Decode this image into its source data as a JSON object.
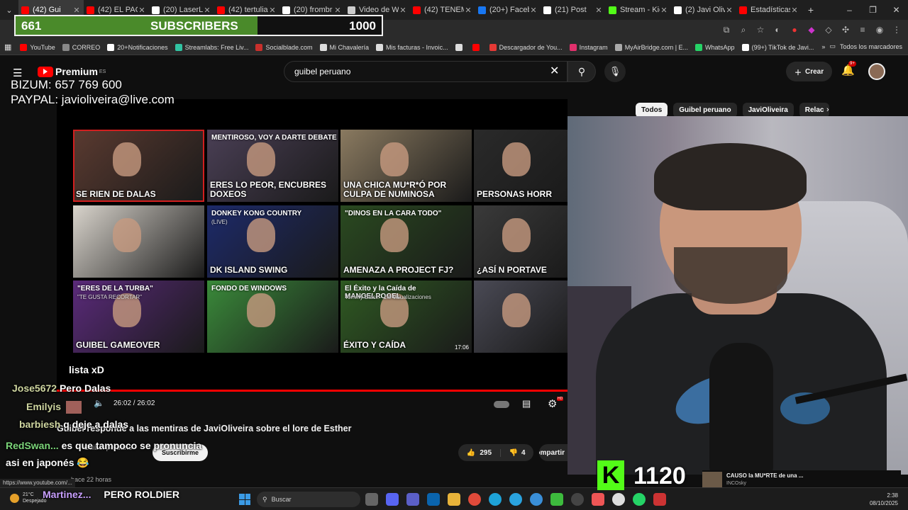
{
  "browser": {
    "tabs": [
      {
        "title": "(42) Gui",
        "color": "#ff0000",
        "active": true
      },
      {
        "title": "(42) EL PACT",
        "color": "#ff0000"
      },
      {
        "title": "(20) LaserLe",
        "color": "#ffffff"
      },
      {
        "title": "(42) tertulia",
        "color": "#ff0000"
      },
      {
        "title": "(20) frombr",
        "color": "#ffffff"
      },
      {
        "title": "Video de W",
        "color": "#cccccc"
      },
      {
        "title": "(42) TENEM",
        "color": "#ff0000"
      },
      {
        "title": "(20+) Facebo",
        "color": "#1877f2"
      },
      {
        "title": "(21) Post",
        "color": "#ffffff"
      },
      {
        "title": "Stream - Kic",
        "color": "#53fc18"
      },
      {
        "title": "(2) Javi Olive",
        "color": "#ffffff"
      },
      {
        "title": "Estadísticas",
        "color": "#ff0000"
      }
    ],
    "bookmarks": [
      {
        "label": "YouTube",
        "color": "#ff0000"
      },
      {
        "label": "CORREO",
        "color": "#888888"
      },
      {
        "label": "20+Notificaciones",
        "color": "#ffffff"
      },
      {
        "label": "Streamlabs: Free Liv...",
        "color": "#31c3a2"
      },
      {
        "label": "Socialblade.com",
        "color": "#c9302c"
      },
      {
        "label": "Mi Chavalería",
        "color": "#dddddd"
      },
      {
        "label": "Mis facturas - Invoic...",
        "color": "#dddddd"
      },
      {
        "label": "",
        "color": "#dddddd"
      },
      {
        "label": "",
        "color": "#ff0000"
      },
      {
        "label": "Descargador de You...",
        "color": "#e53935"
      },
      {
        "label": "Instagram",
        "color": "#e1306c"
      },
      {
        "label": "MyAirBridge.com | E...",
        "color": "#aaaaaa"
      },
      {
        "label": "WhatsApp",
        "color": "#25d366"
      },
      {
        "label": "(99+) TikTok de Javi...",
        "color": "#ffffff"
      }
    ],
    "bookmarks_all": "Todos los marcadores",
    "status_url": "https://www.youtube.com/..."
  },
  "overlay": {
    "subscribers": {
      "current": "661",
      "label": "SUBSCRIBERS",
      "goal": "1000",
      "progress": 0.661
    },
    "donation_lines": [
      "BIZUM: 657 769 600",
      "PAYPAL: javioliveira@live.com"
    ],
    "kick_logo": "K",
    "kick_followers": "1120"
  },
  "youtube": {
    "logo_text": "Premium",
    "logo_region": "ES",
    "search_query": "guibel peruano",
    "create_label": "Crear",
    "notif_badge": "9+",
    "chips": [
      "Todos",
      "Guibel peruano",
      "JaviOliveira",
      "Relac"
    ],
    "player": {
      "time": "26:02 / 26:02",
      "endscreen": [
        {
          "caption": "SE RIEN DE DALAS",
          "bg": "#5a3a30",
          "border": "#d21f1f"
        },
        {
          "caption": "ERES LO PEOR, ENCUBRES DOXEOS",
          "caption2": "MENTIROSO, VOY A DARTE DEBATE",
          "bg": "#4a3f55"
        },
        {
          "caption": "UNA CHICA MU*R*Ó POR CULPA DE NUMINOSA",
          "bg": "#8a7a60"
        },
        {
          "caption": "PERSONAS HORR",
          "bg": "#2a2a2a"
        },
        {
          "caption": "",
          "bg": "#d9d4cc"
        },
        {
          "caption": "DK ISLAND SWING",
          "caption2": "DONKEY KONG COUNTRY",
          "sub": "(LIVE)",
          "bg": "#1d2a6a"
        },
        {
          "caption": "AMENAZA A PROJECT FJ?",
          "caption2": "\"DINOS EN LA CARA TODO\"",
          "bg": "#2a4a20"
        },
        {
          "caption": "¿ASÍ N PORTAVE",
          "bg": "#3a3a3a"
        },
        {
          "caption": "GUIBEL GAMEOVER",
          "caption2": "\"ERES DE LA TURBA\"",
          "sub": "\"TE GUSTA RECORTAR\"",
          "bg": "#5a2a7a"
        },
        {
          "caption": "",
          "caption2": "FONDO DE WINDOWS",
          "bg": "#3a8a3a"
        },
        {
          "caption": "ÉXITO Y CAÍDA",
          "caption2": "El Éxito y la Caída de MANGELROGEL",
          "sub": "Tommy Black · 1M visualizaciones",
          "duration": "17:06",
          "bg": "#2f5a22"
        },
        {
          "caption": "",
          "bg": "#4a4a55"
        }
      ]
    },
    "video_title": "Guibel responde a las mentiras de JaviOliveira sobre el lore de Esther",
    "channel": "Guibel peruano",
    "subscribe_label": "Suscribirme",
    "likes": "295",
    "dislikes": "4",
    "share_label": "Compartir",
    "below_text": "hace 22 horas"
  },
  "chat": [
    {
      "name": "",
      "message": "lista xD"
    },
    {
      "name": "Jose5672",
      "message": "Pero Dalas"
    },
    {
      "name": "Emilyis",
      "message": ""
    },
    {
      "name": "barbiesh",
      "message": "q deje a dalas"
    },
    {
      "name": "RedSwan...",
      "message": "es que tampoco se pronuncia asi en japonés"
    },
    {
      "name": "Martinez...",
      "message": "PERO ROLDIER"
    }
  ],
  "related_video": {
    "title": "CAUSO la MU*RTE de una ...",
    "channel": "INCOsky"
  },
  "taskbar": {
    "weather_temp": "21°C",
    "weather_desc": "Despejado",
    "search_label": "Buscar",
    "time": "2:38",
    "date": "08/10/2025"
  }
}
